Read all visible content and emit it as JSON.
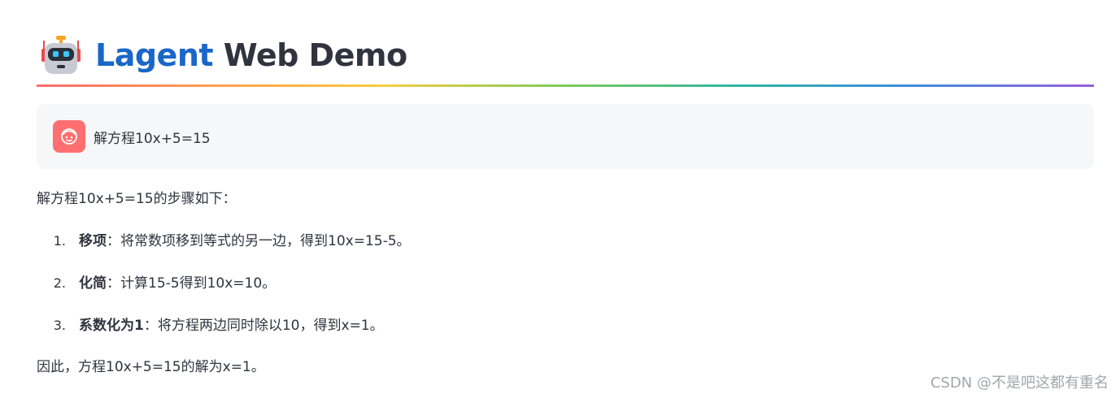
{
  "header": {
    "title_accent": "Lagent",
    "title_rest": " Web Demo",
    "icon": "robot-icon"
  },
  "colors": {
    "title_accent": "#1a67c9",
    "user_avatar_bg": "#ff6f6f",
    "message_bg": "#f6f7f9",
    "text": "#31333f",
    "watermark": "#a4a6ab"
  },
  "user_message": {
    "avatar_icon": "smiley-face-icon",
    "text": "解方程10x+5=15"
  },
  "response": {
    "intro": "解方程10x+5=15的步骤如下：",
    "steps": [
      {
        "number": "1.",
        "title": "移项",
        "separator": "：",
        "detail": "将常数项移到等式的另一边，得到10x=15-5。"
      },
      {
        "number": "2.",
        "title": "化简",
        "separator": "：",
        "detail": "计算15-5得到10x=10。"
      },
      {
        "number": "3.",
        "title": "系数化为1",
        "separator": "：",
        "detail": "将方程两边同时除以10，得到x=1。"
      }
    ],
    "conclusion": "因此，方程10x+5=15的解为x=1。"
  },
  "watermark": "CSDN @不是吧这都有重名"
}
